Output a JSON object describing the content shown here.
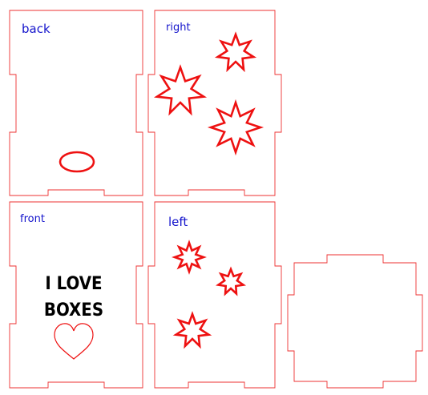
{
  "panels": {
    "back": {
      "label": "back"
    },
    "right": {
      "label": "right"
    },
    "front": {
      "label": "front",
      "headline": [
        "I LOVE",
        "BOXES"
      ]
    },
    "left": {
      "label": "left"
    },
    "bottom": {
      "label": ""
    }
  },
  "colors": {
    "cut_line": "#ee3030",
    "engrave": "#ee1111",
    "label": "#1414cc",
    "headline": "#000000"
  },
  "icons": [
    "ellipse-engraving",
    "seven-point-star-icon",
    "eight-point-star-icon",
    "heart-icon"
  ]
}
